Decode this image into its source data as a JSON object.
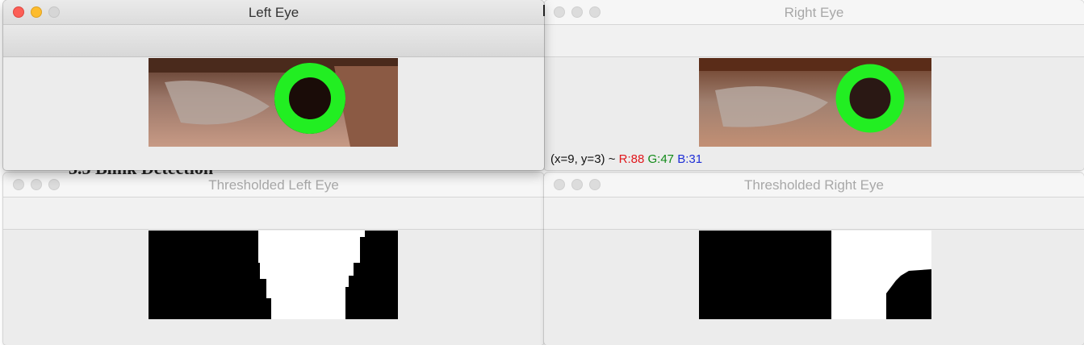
{
  "windows": {
    "left_eye": {
      "title": "Left Eye"
    },
    "right_eye": {
      "title": "Right Eye"
    },
    "thresholded_left_eye": {
      "title": "Thresholded Left Eye"
    },
    "thresholded_right_eye": {
      "title": "Thresholded Right Eye"
    }
  },
  "status_bar": {
    "coords": "(x=9, y=3) ~",
    "r": "R:88",
    "g": "G:47",
    "b": "B:31"
  },
  "background_text": "3.5  Blink Detection",
  "colors": {
    "detection_circle": "#22ee22",
    "close_button": "#fc5f57",
    "minimize_button": "#fdbc2e"
  },
  "icons": [
    "close-button",
    "minimize-button",
    "zoom-button"
  ]
}
